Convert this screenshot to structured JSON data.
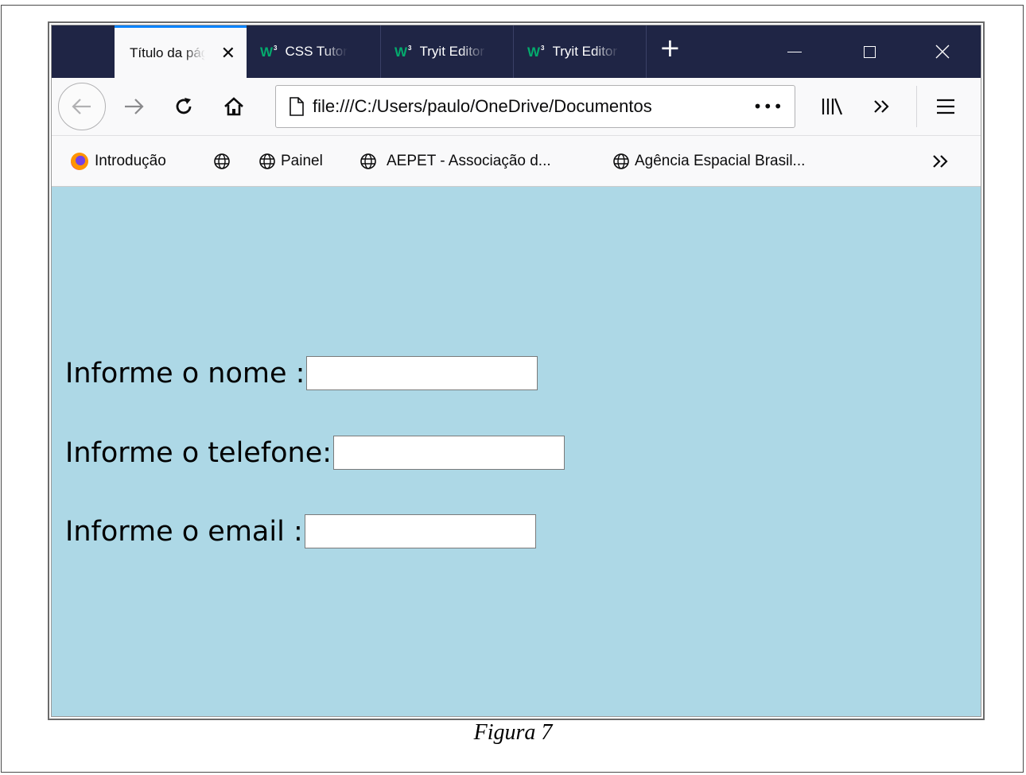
{
  "browser": {
    "tabs": [
      {
        "title": "Título da página",
        "active": true,
        "icon": "none"
      },
      {
        "title": "CSS Tutorial",
        "active": false,
        "icon": "w3schools-icon"
      },
      {
        "title": "Tryit Editor",
        "active": false,
        "icon": "w3schools-icon"
      },
      {
        "title": "Tryit Editor",
        "active": false,
        "icon": "w3schools-icon"
      }
    ],
    "new_tab_label": "+",
    "url": "file:///C:/Users/paulo/OneDrive/Documentos",
    "url_more": "•••",
    "bookmarks": [
      {
        "label": "Introdução",
        "icon": "firefox-icon"
      },
      {
        "label": "",
        "icon": "globe-icon"
      },
      {
        "label": "Painel",
        "icon": "globe-icon"
      },
      {
        "label": "AEPET - Associação d...",
        "icon": "globe-icon"
      },
      {
        "label": "Agência Espacial Brasil...",
        "icon": "globe-icon"
      }
    ],
    "overflow_label": "»",
    "accent_color": "#0a84ff",
    "titlebar_color": "#1f2545"
  },
  "page": {
    "background": "#add8e6",
    "form": {
      "name_label": "Informe o nome :",
      "name_value": "",
      "phone_label": "Informe o telefone:",
      "phone_value": "",
      "email_label": "Informe o email :",
      "email_value": ""
    }
  },
  "caption": "Figura 7"
}
